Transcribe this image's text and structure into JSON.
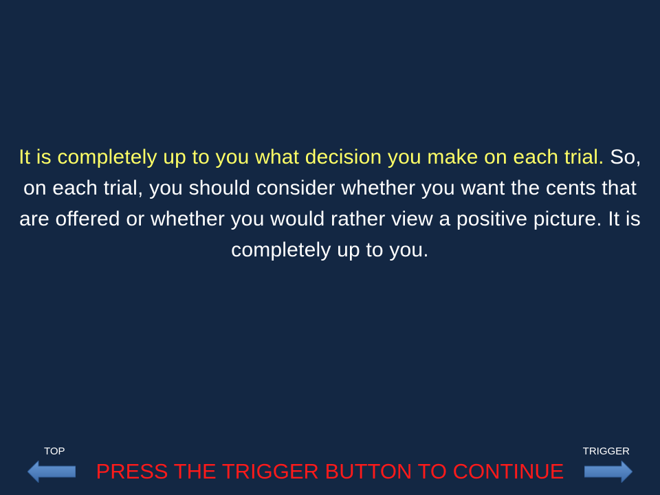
{
  "instruction": {
    "highlighted": "It is completely up to you what decision you make on each trial.",
    "rest": " So, on each trial, you should consider whether you want the cents that are offered or whether you would rather view a positive picture. It is completely up to you."
  },
  "nav": {
    "top_label": "TOP",
    "trigger_label": "TRIGGER",
    "continue_prompt": "PRESS THE TRIGGER BUTTON TO CONTINUE",
    "left_icon": "arrow-left-icon",
    "right_icon": "arrow-right-icon"
  },
  "colors": {
    "background": "#132743",
    "highlight_text": "#ffff66",
    "body_text": "#ffffff",
    "prompt_text": "#ff1a1a",
    "arrow_fill": "#4a7ebb"
  }
}
